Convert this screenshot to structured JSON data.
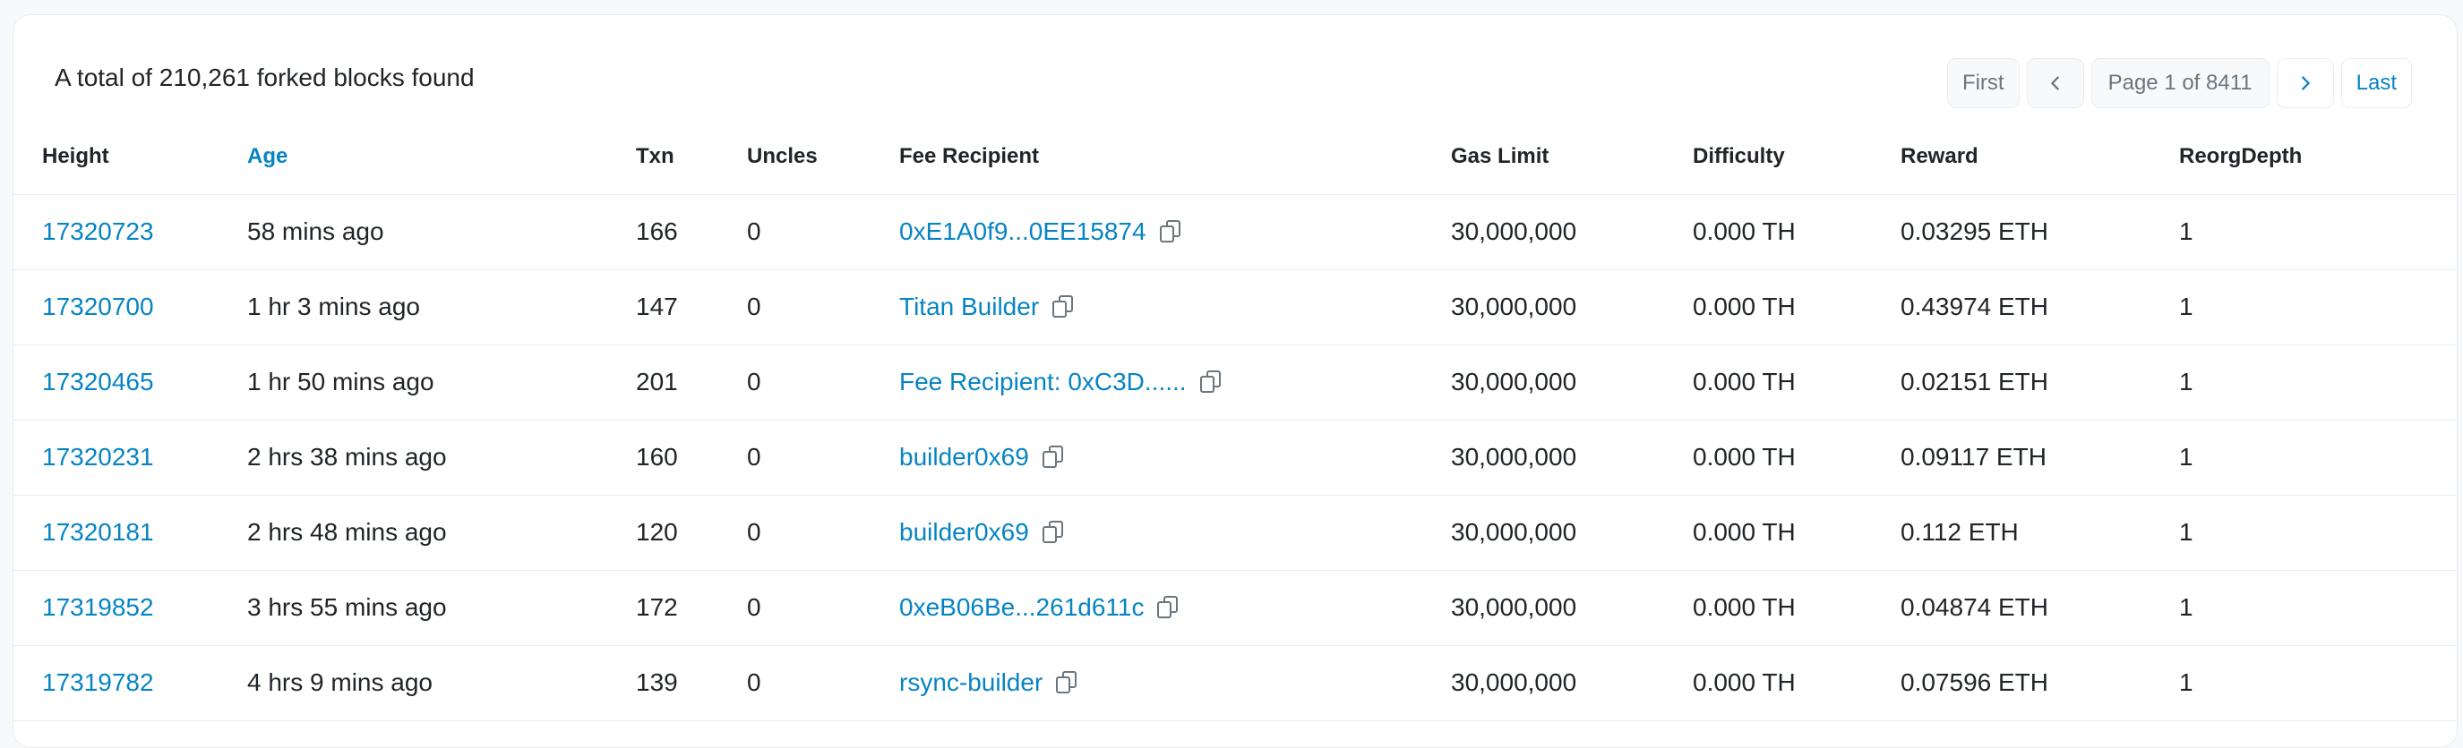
{
  "summary": "A total of 210,261 forked blocks found",
  "pagination": {
    "first": "First",
    "page_info": "Page 1 of 8411",
    "last": "Last",
    "prev_icon": "chevron-left-icon",
    "next_icon": "chevron-right-icon"
  },
  "columns": [
    "Height",
    "Age",
    "Txn",
    "Uncles",
    "Fee Recipient",
    "Gas Limit",
    "Difficulty",
    "Reward",
    "ReorgDepth"
  ],
  "rows": [
    {
      "height": "17320723",
      "age": "58 mins ago",
      "txn": "166",
      "uncles": "0",
      "fee_recipient": "0xE1A0f9...0EE15874",
      "gas_limit": "30,000,000",
      "difficulty": "0.000 TH",
      "reward": "0.03295 ETH",
      "reorg_depth": "1"
    },
    {
      "height": "17320700",
      "age": "1 hr 3 mins ago",
      "txn": "147",
      "uncles": "0",
      "fee_recipient": "Titan Builder",
      "gas_limit": "30,000,000",
      "difficulty": "0.000 TH",
      "reward": "0.43974 ETH",
      "reorg_depth": "1"
    },
    {
      "height": "17320465",
      "age": "1 hr 50 mins ago",
      "txn": "201",
      "uncles": "0",
      "fee_recipient": "Fee Recipient: 0xC3D......",
      "gas_limit": "30,000,000",
      "difficulty": "0.000 TH",
      "reward": "0.02151 ETH",
      "reorg_depth": "1"
    },
    {
      "height": "17320231",
      "age": "2 hrs 38 mins ago",
      "txn": "160",
      "uncles": "0",
      "fee_recipient": "builder0x69",
      "gas_limit": "30,000,000",
      "difficulty": "0.000 TH",
      "reward": "0.09117 ETH",
      "reorg_depth": "1"
    },
    {
      "height": "17320181",
      "age": "2 hrs 48 mins ago",
      "txn": "120",
      "uncles": "0",
      "fee_recipient": "builder0x69",
      "gas_limit": "30,000,000",
      "difficulty": "0.000 TH",
      "reward": "0.112 ETH",
      "reorg_depth": "1"
    },
    {
      "height": "17319852",
      "age": "3 hrs 55 mins ago",
      "txn": "172",
      "uncles": "0",
      "fee_recipient": "0xeB06Be...261d611c",
      "gas_limit": "30,000,000",
      "difficulty": "0.000 TH",
      "reward": "0.04874 ETH",
      "reorg_depth": "1"
    },
    {
      "height": "17319782",
      "age": "4 hrs 9 mins ago",
      "txn": "139",
      "uncles": "0",
      "fee_recipient": "rsync-builder",
      "gas_limit": "30,000,000",
      "difficulty": "0.000 TH",
      "reward": "0.07596 ETH",
      "reorg_depth": "1"
    }
  ],
  "colors": {
    "link": "#0784c3",
    "text": "#212529",
    "muted": "#6c757d",
    "border": "#e9ecef"
  },
  "copy_icon": "copy-icon"
}
